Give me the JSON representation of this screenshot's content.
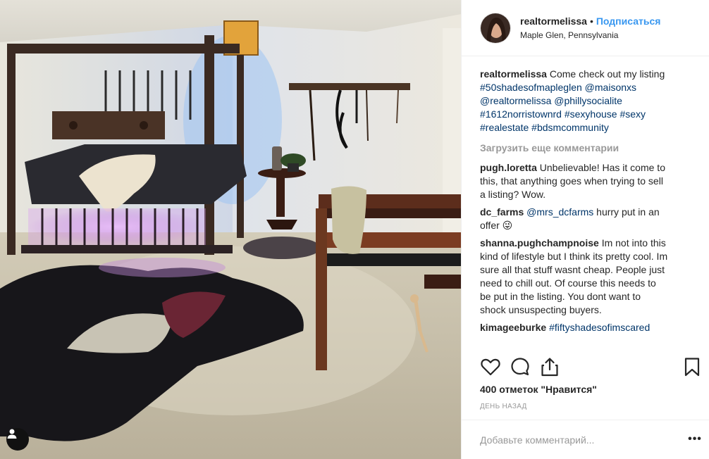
{
  "post": {
    "author": "realtormelissa",
    "separator": "•",
    "follow_label": "Подписаться",
    "location": "Maple Glen, Pennsylvania"
  },
  "caption": {
    "user": "realtormelissa",
    "segments": [
      {
        "text": "Come check out my listing ",
        "type": "text"
      },
      {
        "text": "#50shadesofmapleglen",
        "type": "tag"
      },
      {
        "text": " ",
        "type": "text"
      },
      {
        "text": "@maisonxs",
        "type": "tag"
      },
      {
        "text": " ",
        "type": "text"
      },
      {
        "text": "@realtormelissa",
        "type": "tag"
      },
      {
        "text": " ",
        "type": "text"
      },
      {
        "text": "@phillysocialite",
        "type": "tag"
      },
      {
        "text": " ",
        "type": "text"
      },
      {
        "text": "#1612norristownrd",
        "type": "tag"
      },
      {
        "text": " ",
        "type": "text"
      },
      {
        "text": "#sexyhouse",
        "type": "tag"
      },
      {
        "text": " ",
        "type": "text"
      },
      {
        "text": "#sexy",
        "type": "tag"
      },
      {
        "text": " ",
        "type": "text"
      },
      {
        "text": "#realestate",
        "type": "tag"
      },
      {
        "text": " ",
        "type": "text"
      },
      {
        "text": "#bdsmcommunity",
        "type": "tag"
      }
    ]
  },
  "load_more_label": "Загрузить еще комментарии",
  "comments": [
    {
      "user": "pugh.loretta",
      "segments": [
        {
          "text": "Unbelievable! Has it come to this, that anything goes when trying to sell a listing? Wow.",
          "type": "text"
        }
      ]
    },
    {
      "user": "dc_farms",
      "segments": [
        {
          "text": "@mrs_dcfarms",
          "type": "tag"
        },
        {
          "text": " hurry put in an offer 😜",
          "type": "text"
        }
      ]
    },
    {
      "user": "shanna.pughchampnoise",
      "segments": [
        {
          "text": "Im not into this kind of lifestyle but I think its pretty cool. Im sure all that stuff wasnt cheap. People just need to chill out. Of course this needs to be put in the listing. You dont want to shock unsuspecting buyers.",
          "type": "text"
        }
      ]
    },
    {
      "user": "kimageeburke",
      "segments": [
        {
          "text": "#fiftyshadesofimscared",
          "type": "tag"
        }
      ]
    }
  ],
  "likes_label": "400 отметок \"Нравится\"",
  "timestamp": "ДЕНЬ НАЗАД",
  "add_comment_placeholder": "Добавьте комментарий...",
  "more_label": "•••",
  "icons": {
    "like": "heart-icon",
    "comment": "comment-icon",
    "share": "share-icon",
    "save": "bookmark-icon",
    "comment_like": "heart-icon",
    "user_tags": "person-icon"
  },
  "colors": {
    "link": "#3897f0",
    "tag": "#003569",
    "muted": "#999999",
    "text": "#262626",
    "border": "#efefef"
  }
}
